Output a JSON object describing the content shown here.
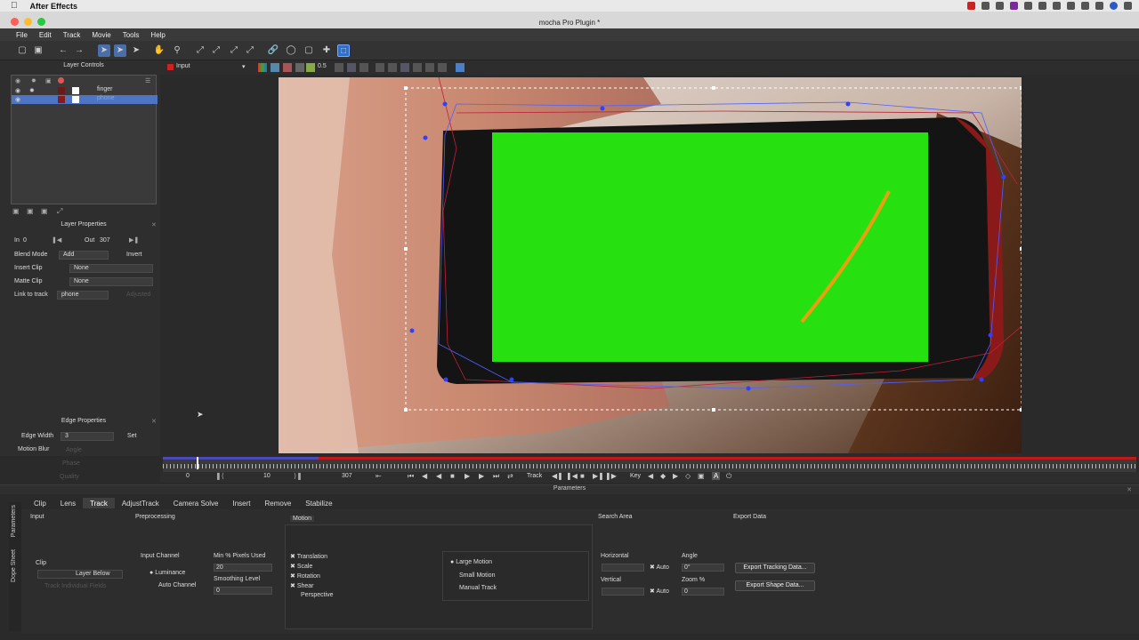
{
  "menubar": {
    "apple": "",
    "app_name": "After Effects"
  },
  "window": {
    "title": "mocha Pro Plugin *"
  },
  "menu": [
    "File",
    "Edit",
    "Track",
    "Movie",
    "Tools",
    "Help"
  ],
  "layer_controls": {
    "header": "Layer Controls",
    "layers": [
      {
        "name": "finger",
        "selected": false
      },
      {
        "name": "phone",
        "selected": true
      }
    ]
  },
  "view_selector": {
    "label": "Input",
    "zoom": "0.5"
  },
  "layer_properties": {
    "header": "Layer Properties",
    "in_label": "In",
    "in_value": "0",
    "out_label": "Out",
    "out_value": "307",
    "blend_mode_label": "Blend Mode",
    "blend_mode_value": "Add",
    "invert_label": "Invert",
    "insert_clip_label": "Insert Clip",
    "insert_clip_value": "None",
    "matte_clip_label": "Matte Clip",
    "matte_clip_value": "None",
    "link_label": "Link to track",
    "link_value": "phone",
    "adjusted_label": "Adjusted"
  },
  "edge_properties": {
    "header": "Edge Properties",
    "edge_width_label": "Edge Width",
    "edge_width_value": "3",
    "set_label": "Set",
    "motion_blur_label": "Motion Blur",
    "angle_label": "Angle",
    "phase_label": "Phase",
    "quality_label": "Quality"
  },
  "transport": {
    "start": "0",
    "mid": "10",
    "end": "307",
    "track_label": "Track",
    "key_label": "Key",
    "timeline_progress": 0.16
  },
  "parameters": {
    "header": "Parameters",
    "tabs": [
      "Clip",
      "Lens",
      "Track",
      "AdjustTrack",
      "Camera Solve",
      "Insert",
      "Remove",
      "Stabilize"
    ],
    "active_tab": "Track",
    "side_tabs": [
      "Parameters",
      "Dope Sheet"
    ],
    "input_label": "Input",
    "clip_label": "Clip",
    "clip_value": "Layer Below",
    "track_individual_label": "Track Individual Fields",
    "preprocessing_label": "Preprocessing",
    "input_channel_label": "Input Channel",
    "luminance_label": "Luminance",
    "auto_channel_label": "Auto Channel",
    "min_pixels_label": "Min % Pixels Used",
    "min_pixels_value": "20",
    "smoothing_label": "Smoothing Level",
    "smoothing_value": "0",
    "motion_label": "Motion",
    "motion_options": [
      {
        "label": "Translation",
        "checked": true
      },
      {
        "label": "Scale",
        "checked": true
      },
      {
        "label": "Rotation",
        "checked": true
      },
      {
        "label": "Shear",
        "checked": true
      },
      {
        "label": "Perspective",
        "checked": false
      }
    ],
    "motion_size": [
      "Large Motion",
      "Small Motion",
      "Manual Track"
    ],
    "search_area_label": "Search Area",
    "horizontal_label": "Horizontal",
    "vertical_label": "Vertical",
    "auto_label": "Auto",
    "angle_label": "Angle",
    "angle_value": "0°",
    "zoom_label": "Zoom %",
    "zoom_value": "0",
    "export_data_label": "Export Data",
    "export_tracking": "Export Tracking Data...",
    "export_shape": "Export Shape Data..."
  }
}
